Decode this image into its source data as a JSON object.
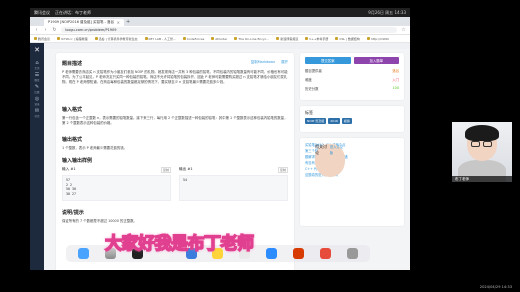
{
  "meeting": {
    "app": "腾讯会议",
    "recording": "正在讲话：布丁老师",
    "clock": "9月26日 周五 14:33"
  },
  "browser": {
    "tab_title": "P1909 [NOIP2016 普及组] 买铅笔 - 洛谷",
    "url": "luogu.com.cn/problem/P1909",
    "bookmarks": [
      "腾讯会议",
      "ICTW.cc | 编程教程",
      "洛谷 | 计算机科学教育新生态",
      "KEY LAB - 人工智...",
      "CodeForces",
      "AtCoder",
      "The On-Line Encyc...",
      "新浪博客频道",
      "C++参考手册",
      "CSL | 数据结构",
      "http://CSDN"
    ]
  },
  "luogu": {
    "nav": [
      {
        "icon": "⌂",
        "label": "主页"
      },
      {
        "icon": "☰",
        "label": "题库"
      },
      {
        "icon": "✎",
        "label": "比赛"
      },
      {
        "icon": "◎",
        "label": "记录"
      },
      {
        "icon": "✉",
        "label": "讨论"
      }
    ],
    "problem": {
      "desc_title": "题目描述",
      "copy_md": "复制Markdown",
      "expand": "展开",
      "desc_text": "P 老师需要去商店买 n 支铅笔作为小朋友们参加 NOIP 的礼物。她发现商店一共有 3 种包装的铅笔，不同包装内的铅笔数量有可能不同，价格也有可能不同。为了公平起见，P 老师决定只买同一种包装的铅笔。商店不允许将铅笔的包装拆开，因此 P 老师可能需要购买超过 n 支铅笔才够给小朋友们发礼物。现在 P 老师想知道，在商店每种包装的数量都足够的情况下，要买够至少 n 支铅笔最少需要花费多少钱。",
      "input_title": "输入格式",
      "input_text": "第一行包含一个正整数 n，表示需要的铅笔数量。接下来三行，每行用 2 个正整数描述一种包装的铅笔：其中第 1 个整数表示这种包装内铅笔的数量，第 2 个整数表示这种包装的价格。",
      "output_title": "输出格式",
      "output_text": "1 个整数，表示 P 老师最少需要花费的钱。",
      "samples_title": "输入输出样例",
      "in_label": "输入 #1",
      "out_label": "输出 #1",
      "copy": "复制",
      "sample_in": "57\n2 2\n50 30\n30 27",
      "sample_out": "54",
      "hint_title": "说明/提示",
      "hint_text": "保证所有的 7 个数都是不超过 10000 的正整数。"
    },
    "panel": {
      "submit": "提交答案",
      "add_list": "加入题单",
      "uploader_label": "题目提供者",
      "uploader": "洛谷",
      "difficulty_label": "难度",
      "difficulty": "入门",
      "history_label": "历史分数",
      "history": "100",
      "tags_title": "标签",
      "tags": [
        "NOIP 普及组",
        "2016",
        "模拟"
      ],
      "discuss_title": "相关讨论",
      "discuss_more": "进入讨论版",
      "discussions": [
        "买铅笔为什么 WA 了两个点",
        "第三个样例怎么过",
        "题解求助：为什么用 int 会错",
        "有没有更简单的做法",
        "C++ 代码求调",
        "这题真的是入门难度吗"
      ]
    }
  },
  "subtitle": "大家好我是布丁老师",
  "webcam": {
    "name": "布丁老师"
  },
  "timestamp": "2024/04/29 14:33",
  "colors": {
    "luogu_nav": "#1d2a3d",
    "submit": "#3498db",
    "add_list": "#8e44ad",
    "subtitle_stroke": "#e0408f"
  }
}
